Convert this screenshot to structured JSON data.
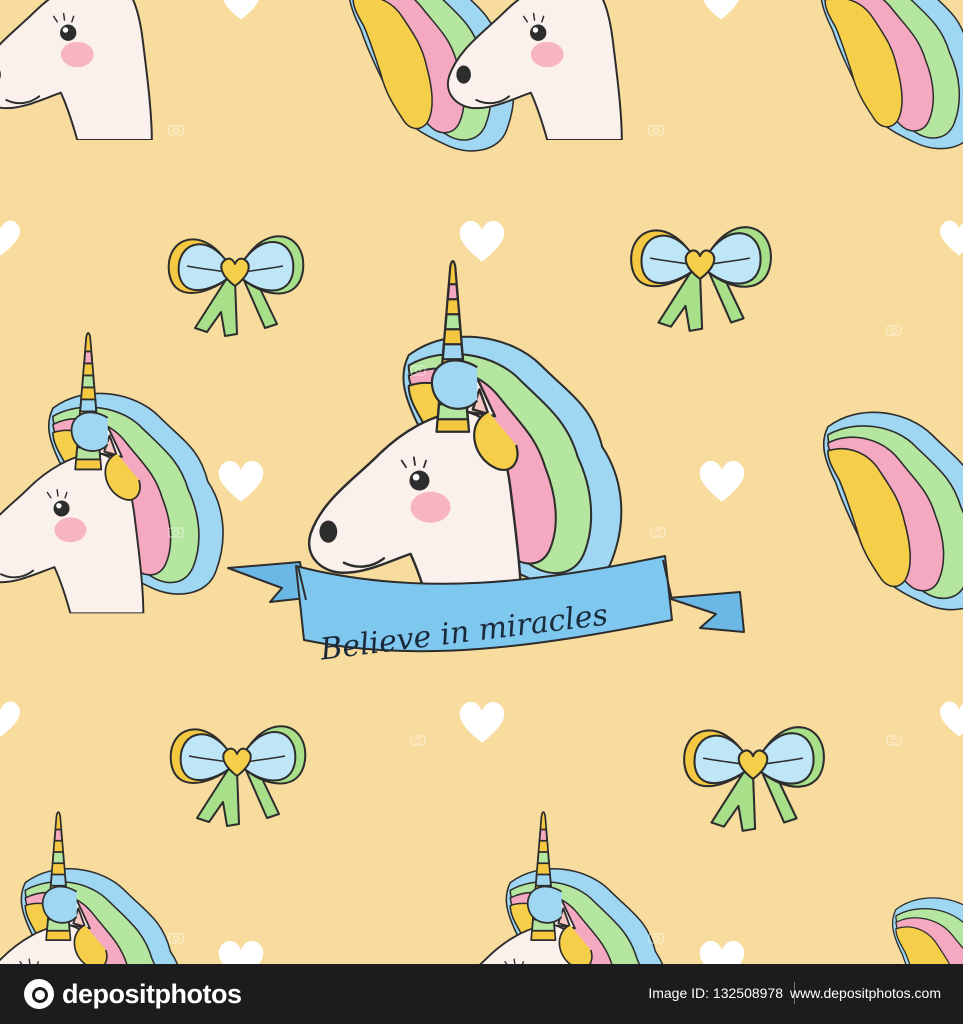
{
  "ribbon": {
    "text": "Believe in miracles"
  },
  "footer": {
    "brand": "depositphotos",
    "image_id": "Image ID: 132508978",
    "site": "www.depositphotos.com"
  },
  "colors": {
    "background": "#f8dc9e",
    "ribbon": "#7ec7ee",
    "heart": "#ffffff",
    "footer": "#1c1c1e"
  }
}
